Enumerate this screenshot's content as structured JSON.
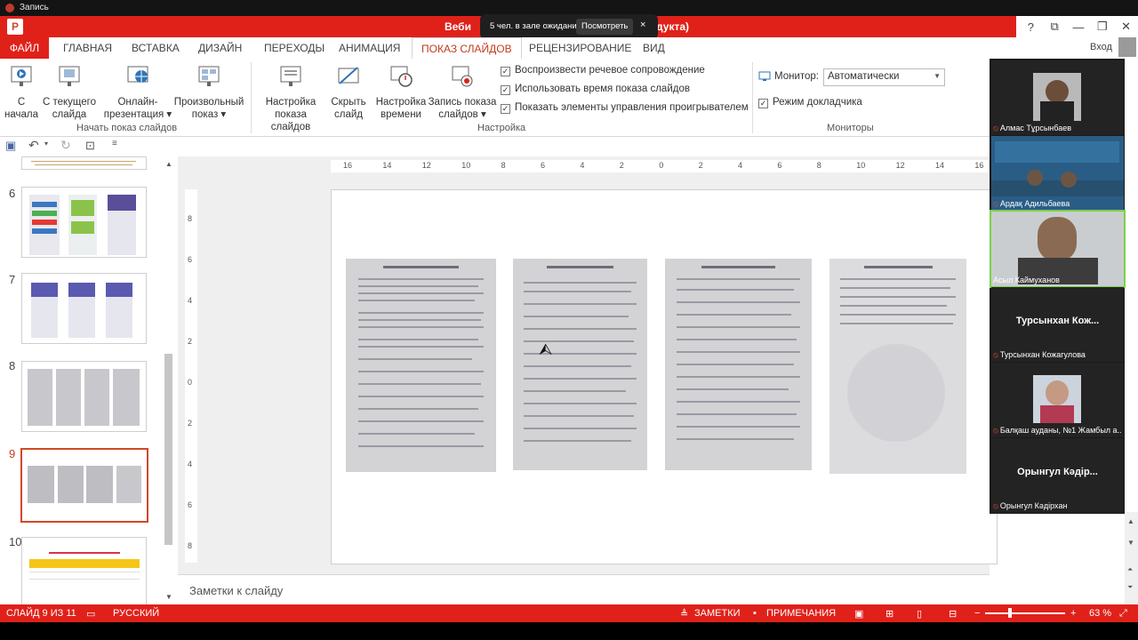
{
  "recorder_title": "Запись",
  "window": {
    "title_left": "Веби",
    "title_right": "дукта)",
    "help": "?",
    "login": "Вход"
  },
  "waiting_popup": {
    "text": "5 чел. в зале ожидания",
    "button": "Посмотреть",
    "close": "×"
  },
  "tabs": {
    "file": "ФАЙЛ",
    "home": "ГЛАВНАЯ",
    "insert": "ВСТАВКА",
    "design": "ДИЗАЙН",
    "transitions": "ПЕРЕХОДЫ",
    "animation": "АНИМАЦИЯ",
    "slideshow": "ПОКАЗ СЛАЙДОВ",
    "review": "РЕЦЕНЗИРОВАНИЕ",
    "view": "ВИД"
  },
  "ribbon": {
    "from_start": [
      "С",
      "начала"
    ],
    "from_current": [
      "С текущего",
      "слайда"
    ],
    "online": [
      "Онлайн-",
      "презентация ▾"
    ],
    "custom": [
      "Произвольный",
      "показ ▾"
    ],
    "group_start": "Начать показ слайдов",
    "setup": [
      "Настройка",
      "показа слайдов"
    ],
    "hide": [
      "Скрыть",
      "слайд"
    ],
    "timing": [
      "Настройка",
      "времени"
    ],
    "record": [
      "Запись показа",
      "слайдов ▾"
    ],
    "chk_narration": "Воспроизвести речевое сопровождение",
    "chk_timings": "Использовать время показа слайдов",
    "chk_controls": "Показать элементы управления проигрывателем",
    "group_setup": "Настройка",
    "monitor_label": "Монитор:",
    "monitor_value": "Автоматически",
    "presenter_view": "Режим докладчика",
    "group_monitors": "Мониторы"
  },
  "slides": {
    "numbers": [
      "6",
      "7",
      "8",
      "9",
      "10"
    ]
  },
  "ruler": {
    "h": [
      "16",
      "14",
      "12",
      "10",
      "8",
      "6",
      "4",
      "2",
      "0",
      "2",
      "4",
      "6",
      "8",
      "10",
      "12",
      "14",
      "16"
    ],
    "v": [
      "8",
      "6",
      "4",
      "2",
      "0",
      "2",
      "4",
      "6",
      "8"
    ]
  },
  "notes_placeholder": "Заметки к слайду",
  "participants": [
    {
      "name": "Алмас Тұрсынбаев",
      "video": true
    },
    {
      "name": "Ардақ Адильбаева",
      "video": true
    },
    {
      "name": "Асыл Каймуханов",
      "video": true
    },
    {
      "name": "Турсынхан Кожагулова",
      "display": "Турсынхан  Кож...",
      "video": false
    },
    {
      "name": "Балқаш ауданы, №1 Жамбыл а...",
      "video": true
    },
    {
      "name": "Орынгул Кәдірхан",
      "display": "Орынгул  Кәдір...",
      "video": false
    }
  ],
  "status": {
    "slide": "СЛАЙД 9 ИЗ 11",
    "language": "РУССКИЙ",
    "notes": "ЗАМЕТКИ",
    "comments": "ПРИМЕЧАНИЯ",
    "zoom": "63 %"
  },
  "colors": {
    "accent": "#e0211a",
    "active_tab_text": "#c43b1c"
  }
}
